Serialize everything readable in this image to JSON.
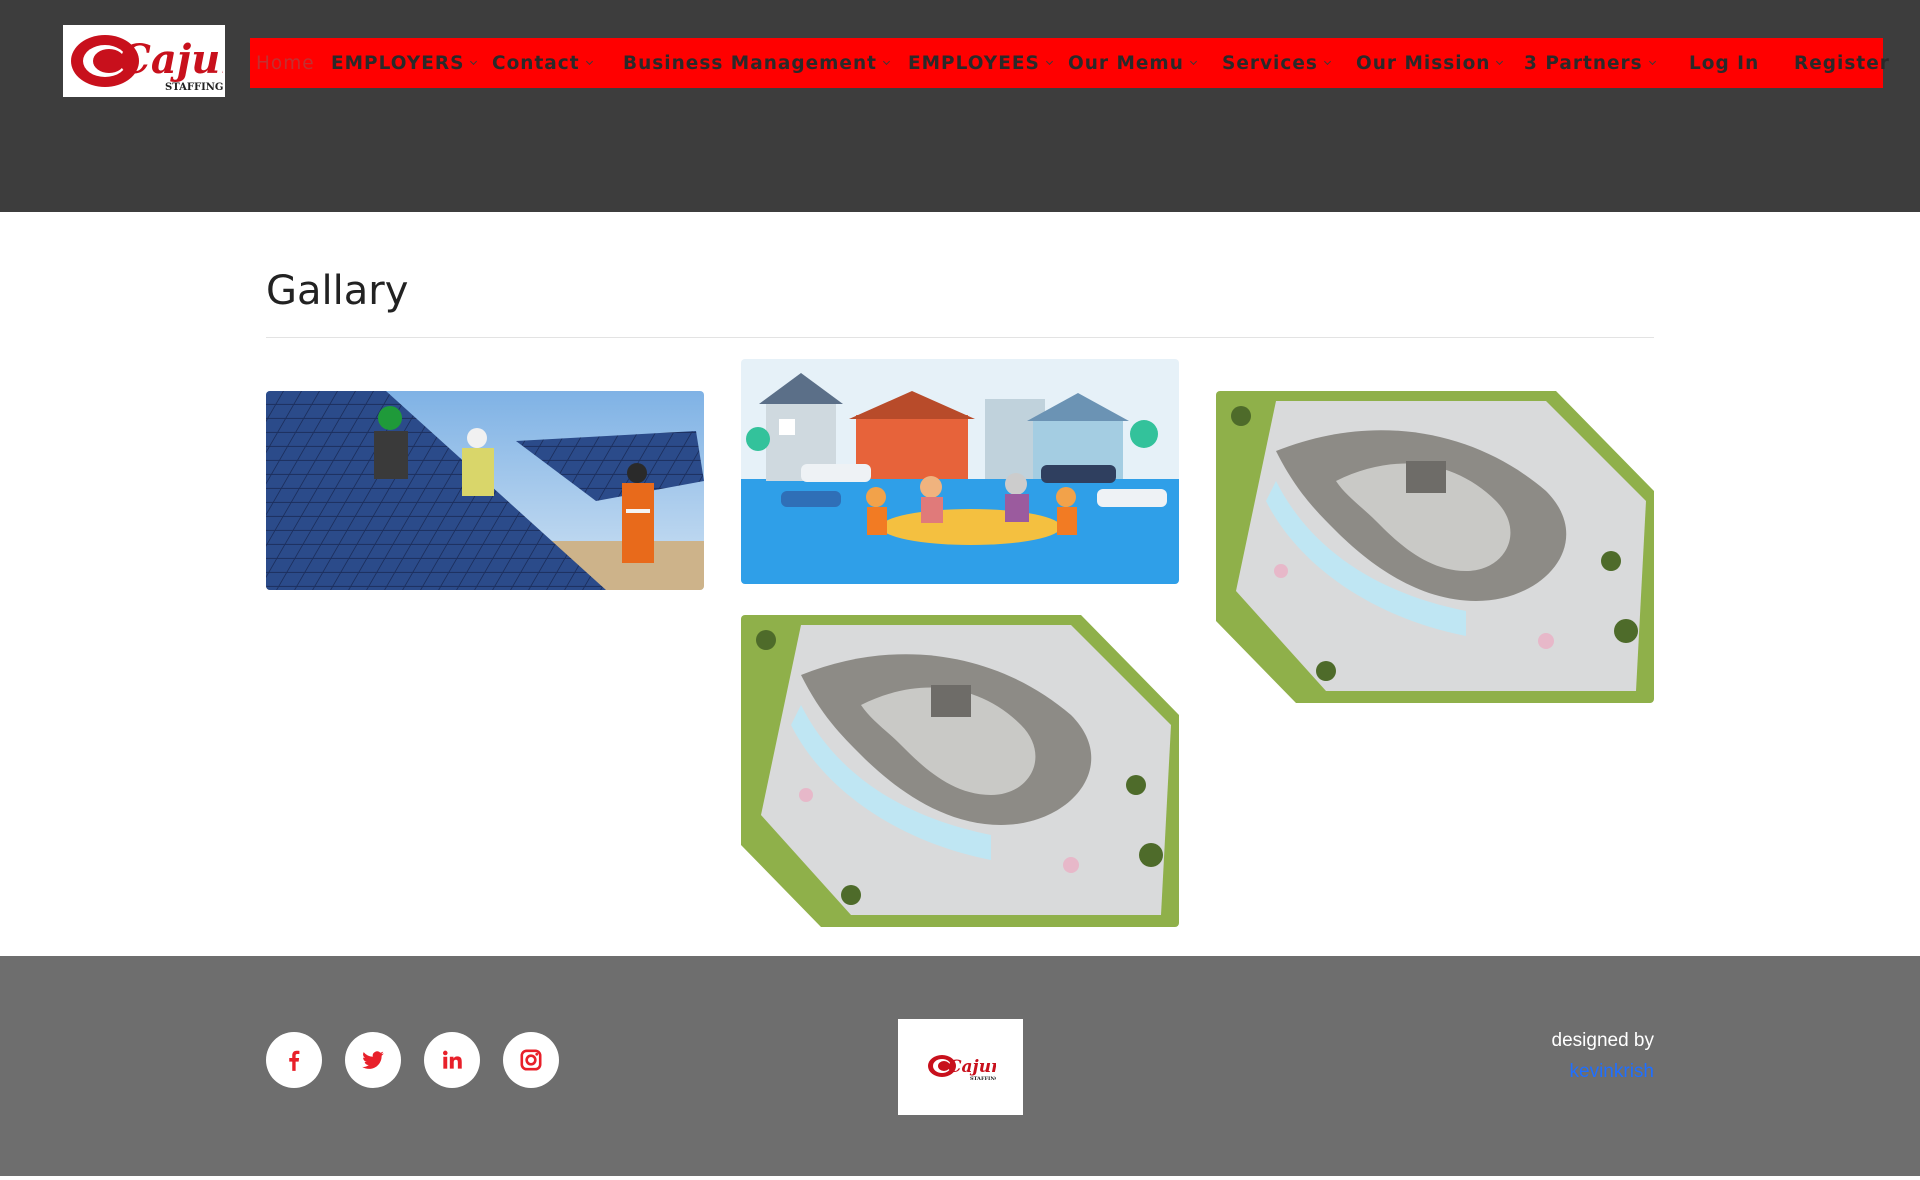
{
  "header": {
    "logo": {
      "text": "Cajun",
      "subtext": "STAFFING"
    },
    "nav": [
      {
        "label": "Home",
        "dropdown": false,
        "active": true
      },
      {
        "label": "EMPLOYERS",
        "dropdown": true
      },
      {
        "label": "Contact",
        "dropdown": true
      },
      {
        "label": "Business Management",
        "dropdown": true
      },
      {
        "label": "EMPLOYEES",
        "dropdown": true
      },
      {
        "label": "Our Memu",
        "dropdown": true
      },
      {
        "label": "Services",
        "dropdown": true
      },
      {
        "label": "Our Mission",
        "dropdown": true
      },
      {
        "label": "3 Partners",
        "dropdown": true
      },
      {
        "label": "Log In",
        "dropdown": false
      },
      {
        "label": "Register",
        "dropdown": false
      }
    ]
  },
  "main": {
    "title": "Gallary",
    "gallery": [
      {
        "subject": "solar panel installation workers"
      },
      {
        "subject": "flood rescue illustration"
      },
      {
        "subject": "aerial building architecture render"
      },
      {
        "subject": "aerial building architecture render"
      }
    ]
  },
  "footer": {
    "social": [
      "facebook-icon",
      "twitter-icon",
      "linkedin-icon",
      "instagram-icon"
    ],
    "designed_by": "designed by",
    "designer": "kevinkrish"
  },
  "colors": {
    "header_bg": "#3d3d3d",
    "nav_bg": "#ff0000",
    "footer_bg": "#6e6e6e",
    "brand_red": "#d01e2a",
    "link_blue": "#1f6fff"
  }
}
